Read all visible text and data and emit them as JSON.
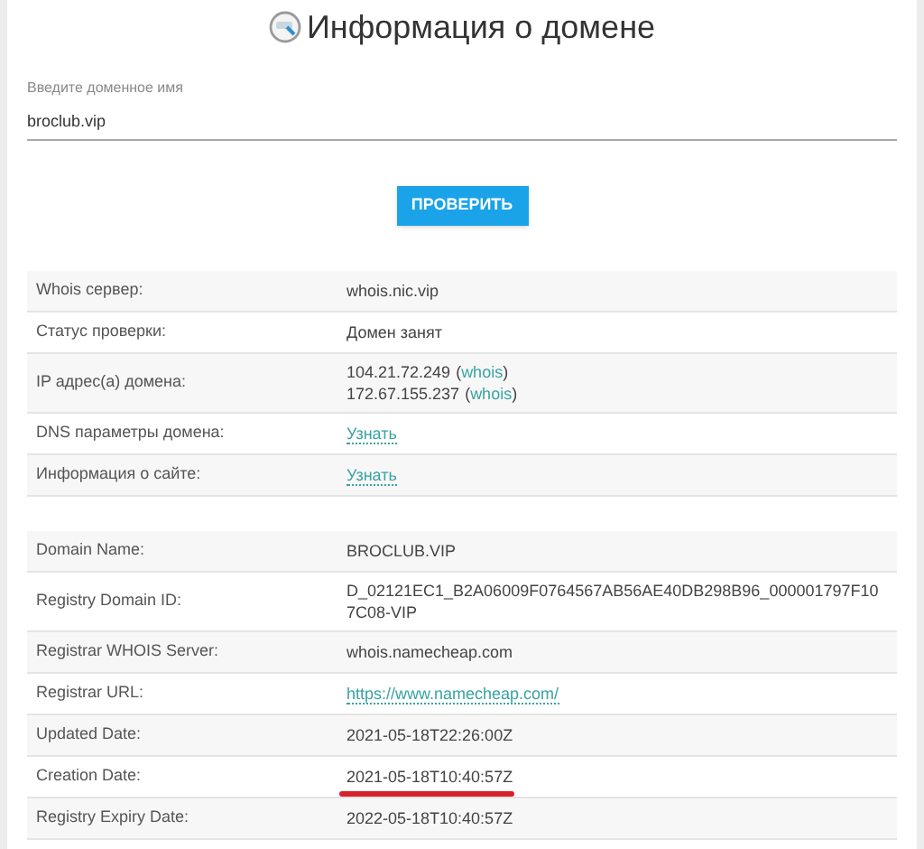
{
  "title": "Информация о домене",
  "domain_field": {
    "label": "Введите доменное имя",
    "value": "broclub.vip"
  },
  "check_button": "ПРОВЕРИТЬ",
  "summary_table": {
    "rows": [
      {
        "label": "Whois сервер:",
        "values": [
          {
            "kind": "text",
            "text": "whois.nic.vip"
          }
        ]
      },
      {
        "label": "Статус проверки:",
        "values": [
          {
            "kind": "text",
            "text": "Домен занят"
          }
        ]
      },
      {
        "label": "IP адрес(а) домена:",
        "values": [
          {
            "kind": "ip",
            "text": "104.21.72.249",
            "open": "(",
            "link": "whois",
            "close": ")"
          },
          {
            "kind": "ip",
            "text": "172.67.155.237",
            "open": "(",
            "link": "whois",
            "close": ")"
          }
        ]
      },
      {
        "label": "DNS параметры домена:",
        "values": [
          {
            "kind": "link",
            "text": "Узнать"
          }
        ]
      },
      {
        "label": "Информация о сайте:",
        "values": [
          {
            "kind": "link",
            "text": "Узнать"
          }
        ]
      }
    ]
  },
  "whois_table": {
    "rows": [
      {
        "label": "Domain Name:",
        "values": [
          {
            "kind": "text",
            "text": "BROCLUB.VIP"
          }
        ],
        "underlined": false
      },
      {
        "label": "Registry Domain ID:",
        "values": [
          {
            "kind": "text",
            "text": "D_02121EC1_B2A06009F0764567AB56AE40DB298B96_000001797F107C08-VIP"
          }
        ],
        "underlined": false
      },
      {
        "label": "Registrar WHOIS Server:",
        "values": [
          {
            "kind": "text",
            "text": "whois.namecheap.com"
          }
        ],
        "underlined": false
      },
      {
        "label": "Registrar URL:",
        "values": [
          {
            "kind": "link",
            "text": "https://www.namecheap.com/"
          }
        ],
        "underlined": false
      },
      {
        "label": "Updated Date:",
        "values": [
          {
            "kind": "text",
            "text": "2021-05-18T22:26:00Z"
          }
        ],
        "underlined": false
      },
      {
        "label": "Creation Date:",
        "values": [
          {
            "kind": "text",
            "text": "2021-05-18T10:40:57Z"
          }
        ],
        "underlined": true
      },
      {
        "label": "Registry Expiry Date:",
        "values": [
          {
            "kind": "text",
            "text": "2022-05-18T10:40:57Z"
          }
        ],
        "underlined": false
      }
    ]
  }
}
